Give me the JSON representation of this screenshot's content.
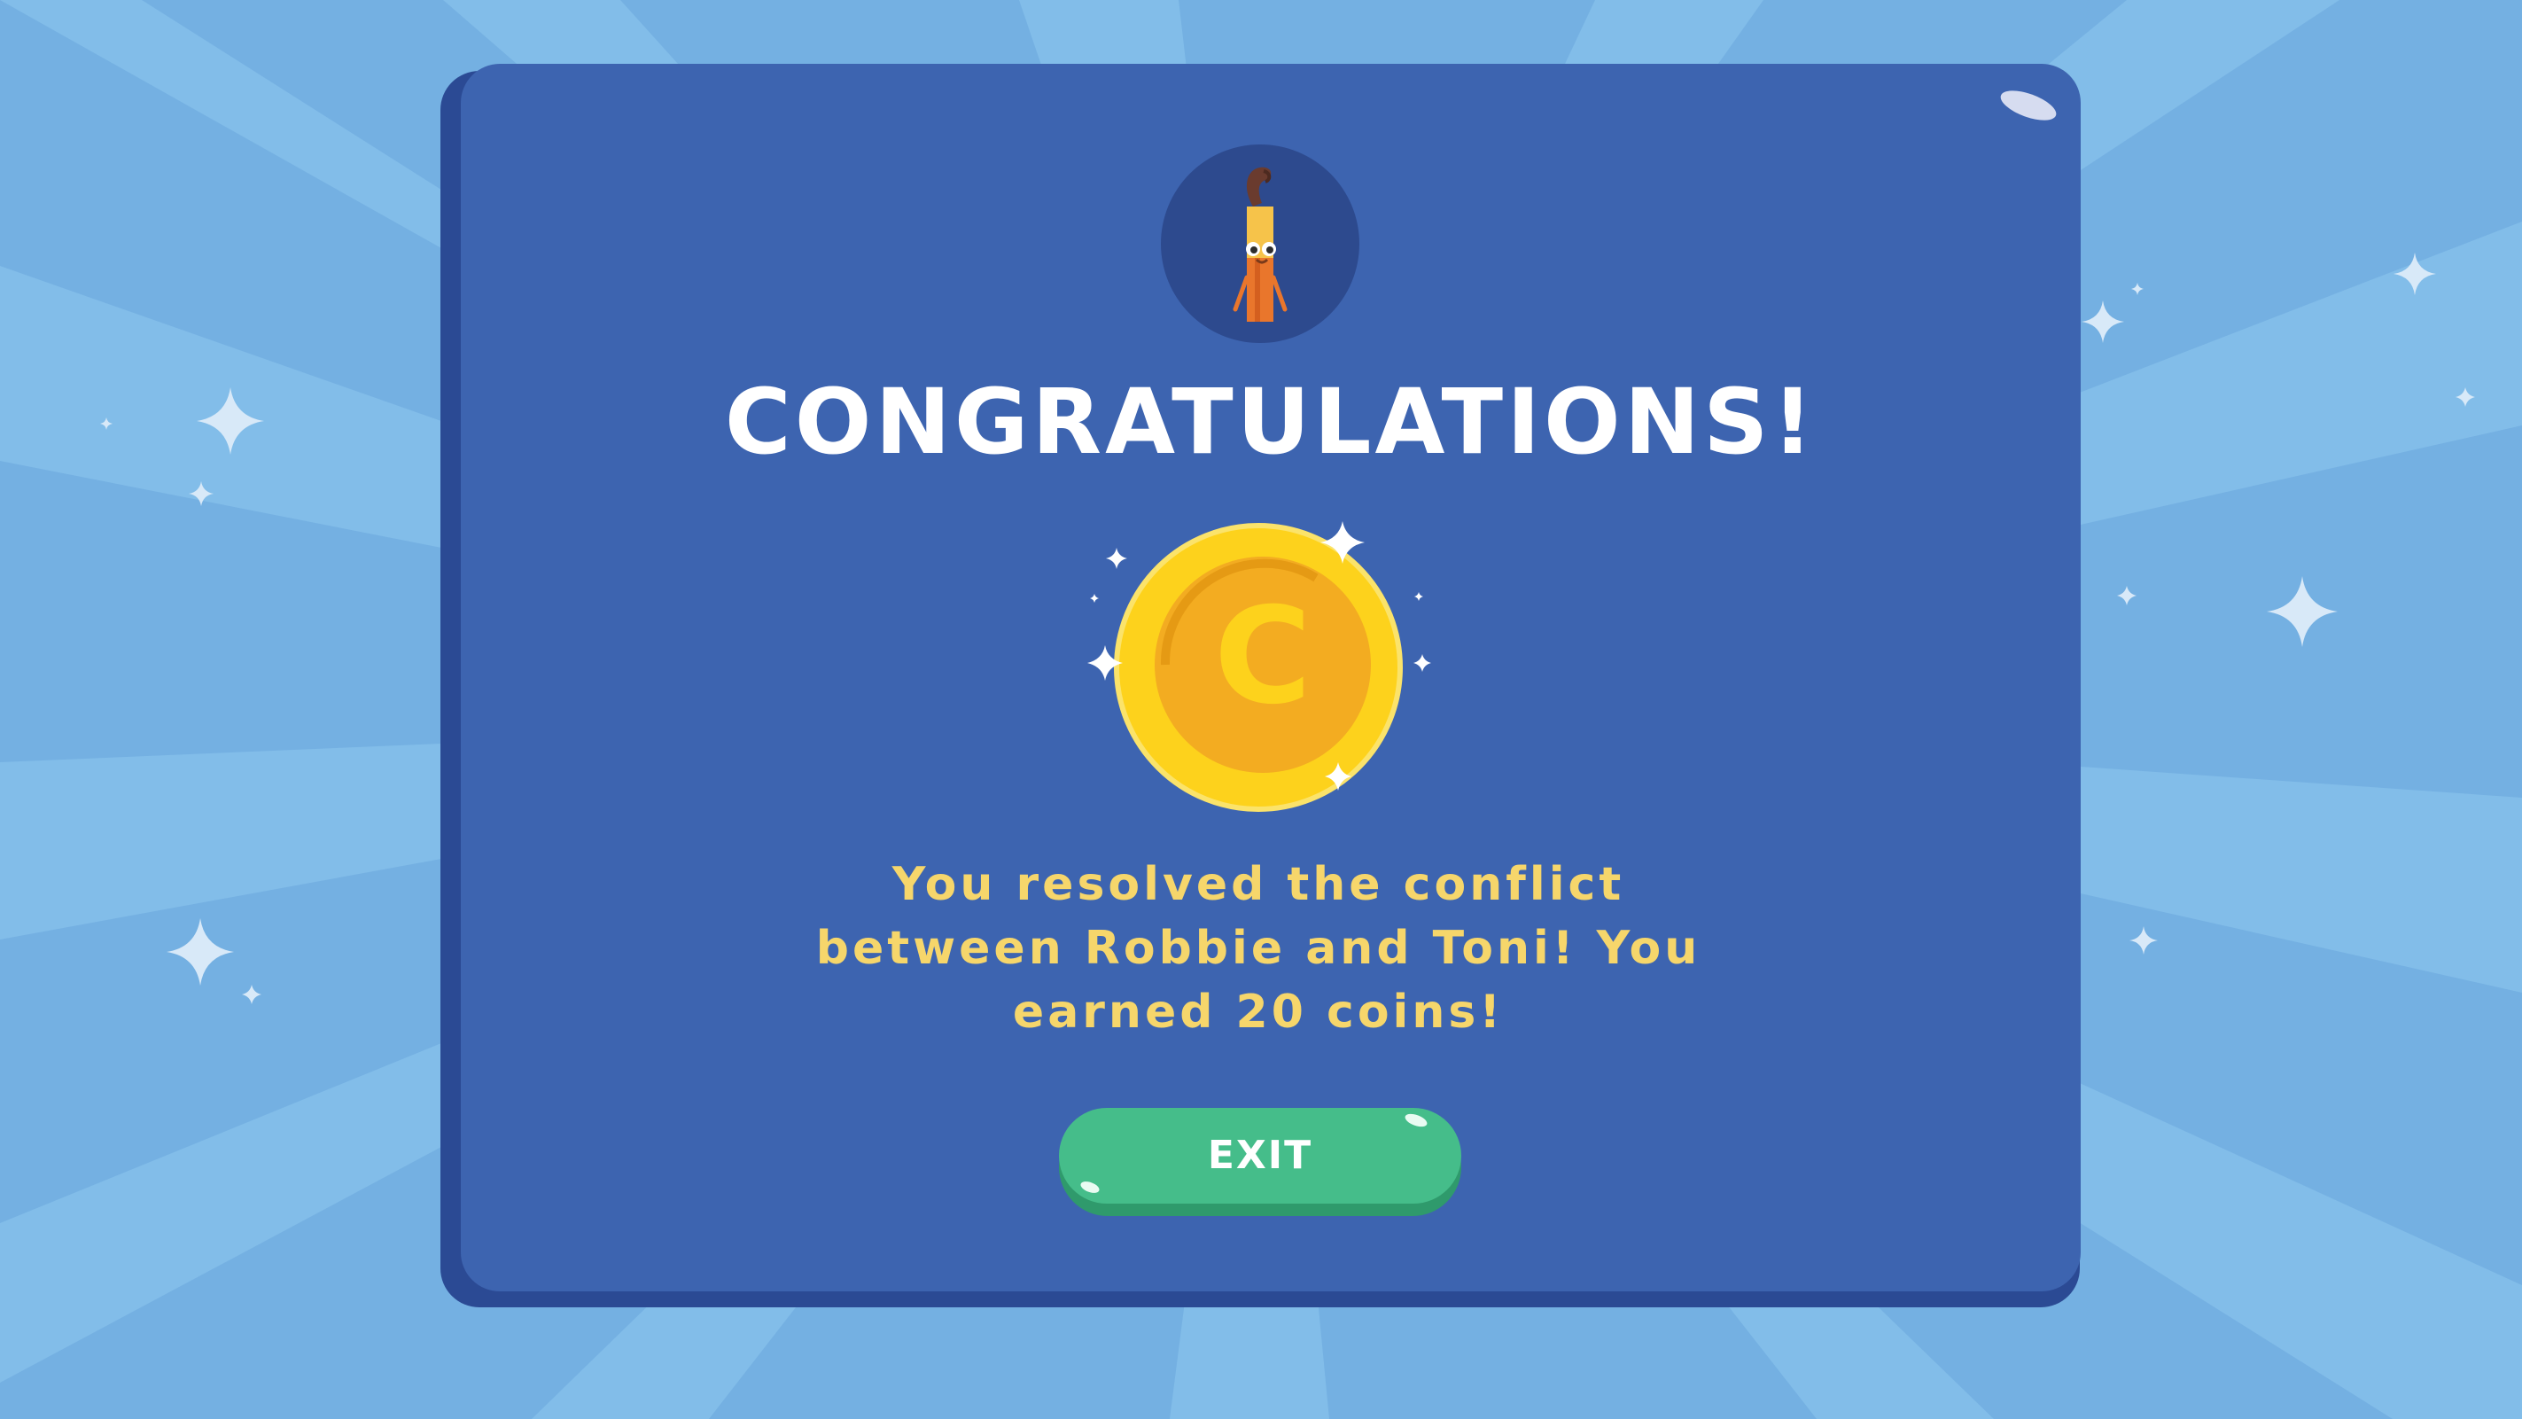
{
  "dialog": {
    "title": "CONGRATULATIONS!",
    "message": "You resolved the conflict between Robbie and Toni! You earned 20 coins!",
    "exit_label": "EXIT",
    "coin_letter": "C"
  },
  "icons": {
    "avatar": "pencil-character-avatar",
    "coin": "gold-coin-icon",
    "sparkle": "sparkle-icon"
  },
  "colors": {
    "background": "#74b0e2",
    "panel": "#3d64b0",
    "panel_shadow": "#2b4a94",
    "title": "#ffffff",
    "message": "#f6d66b",
    "exit_button": "#45bd8a",
    "coin_outer": "#fdd21c",
    "coin_inner": "#f3ac21"
  }
}
